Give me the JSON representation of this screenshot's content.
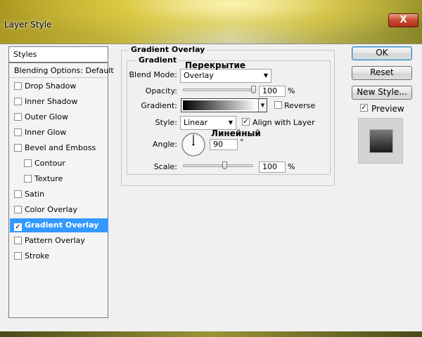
{
  "window": {
    "title": "Layer Style",
    "close_glyph": "X"
  },
  "styles_panel": {
    "header": "Styles",
    "items": [
      {
        "label": "Blending Options: Default",
        "has_checkbox": false,
        "checked": false,
        "indent": false,
        "selected": false
      },
      {
        "label": "Drop Shadow",
        "has_checkbox": true,
        "checked": false,
        "indent": false,
        "selected": false
      },
      {
        "label": "Inner Shadow",
        "has_checkbox": true,
        "checked": false,
        "indent": false,
        "selected": false
      },
      {
        "label": "Outer Glow",
        "has_checkbox": true,
        "checked": false,
        "indent": false,
        "selected": false
      },
      {
        "label": "Inner Glow",
        "has_checkbox": true,
        "checked": false,
        "indent": false,
        "selected": false
      },
      {
        "label": "Bevel and Emboss",
        "has_checkbox": true,
        "checked": false,
        "indent": false,
        "selected": false
      },
      {
        "label": "Contour",
        "has_checkbox": true,
        "checked": false,
        "indent": true,
        "selected": false
      },
      {
        "label": "Texture",
        "has_checkbox": true,
        "checked": false,
        "indent": true,
        "selected": false
      },
      {
        "label": "Satin",
        "has_checkbox": true,
        "checked": false,
        "indent": false,
        "selected": false
      },
      {
        "label": "Color Overlay",
        "has_checkbox": true,
        "checked": false,
        "indent": false,
        "selected": false
      },
      {
        "label": "Gradient Overlay",
        "has_checkbox": true,
        "checked": true,
        "indent": false,
        "selected": true
      },
      {
        "label": "Pattern Overlay",
        "has_checkbox": true,
        "checked": false,
        "indent": false,
        "selected": false
      },
      {
        "label": "Stroke",
        "has_checkbox": true,
        "checked": false,
        "indent": false,
        "selected": false
      }
    ]
  },
  "gradient_overlay": {
    "section_title": "Gradient Overlay",
    "group_title": "Gradient",
    "blend_mode": {
      "label": "Blend Mode:",
      "value": "Overlay"
    },
    "opacity": {
      "label": "Opacity:",
      "value": "100",
      "unit": "%",
      "slider_fraction": 1.0
    },
    "gradient": {
      "label": "Gradient:",
      "reverse_label": "Reverse",
      "reverse_checked": false
    },
    "style": {
      "label": "Style:",
      "value": "Linear",
      "align_label": "Align with Layer",
      "align_checked": true
    },
    "angle": {
      "label": "Angle:",
      "value": "90",
      "unit": "°",
      "degrees": 90
    },
    "scale": {
      "label": "Scale:",
      "value": "100",
      "unit": "%",
      "slider_fraction": 0.6
    }
  },
  "annotations": {
    "blend_mode_note": "Перекрытие",
    "style_note": "Линейный"
  },
  "buttons": {
    "ok": "OK",
    "reset": "Reset",
    "new_style": "New Style...",
    "preview_label": "Preview",
    "preview_checked": true
  },
  "colors": {
    "selection": "#3399ff",
    "dialog_bg": "#f0f0f0"
  },
  "icons": {
    "checkmark": "✓",
    "dropdown": "▼"
  }
}
